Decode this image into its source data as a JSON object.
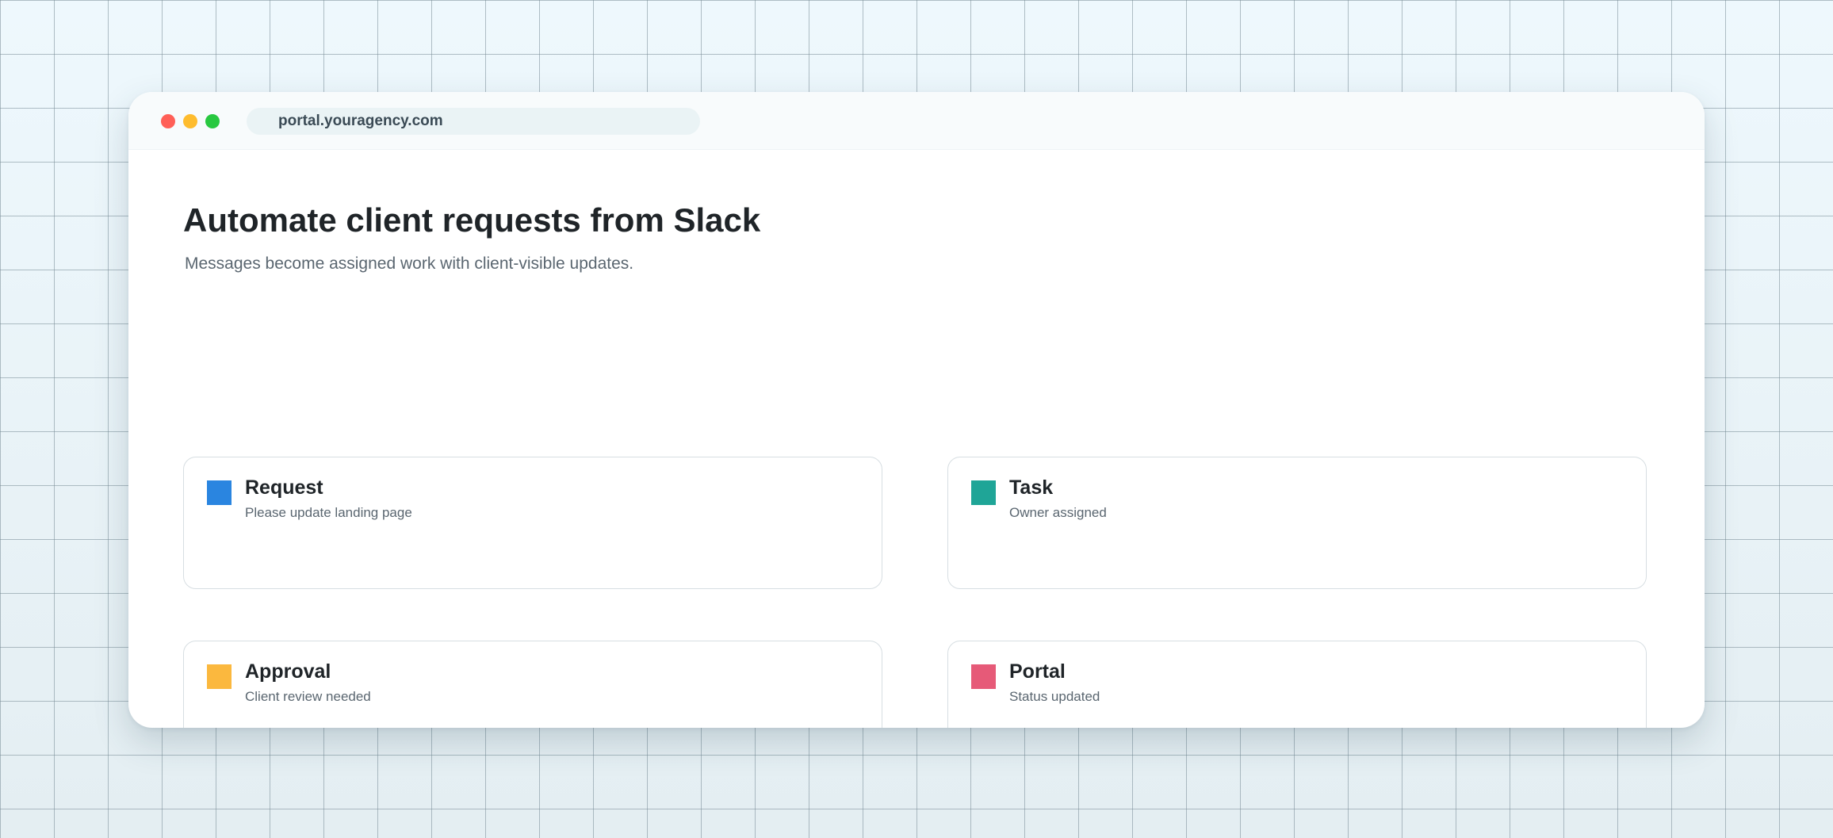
{
  "browser": {
    "url": "portal.youragency.com"
  },
  "page": {
    "title": "Automate client requests from Slack",
    "subtitle": "Messages become assigned work with client-visible updates."
  },
  "cards": [
    {
      "title": "Request",
      "description": "Please update landing page",
      "color": "#2a85e0"
    },
    {
      "title": "Task",
      "description": "Owner assigned",
      "color": "#1fa597"
    },
    {
      "title": "Approval",
      "description": "Client review needed",
      "color": "#fbb83e"
    },
    {
      "title": "Portal",
      "description": "Status updated",
      "color": "#e65a78"
    }
  ]
}
